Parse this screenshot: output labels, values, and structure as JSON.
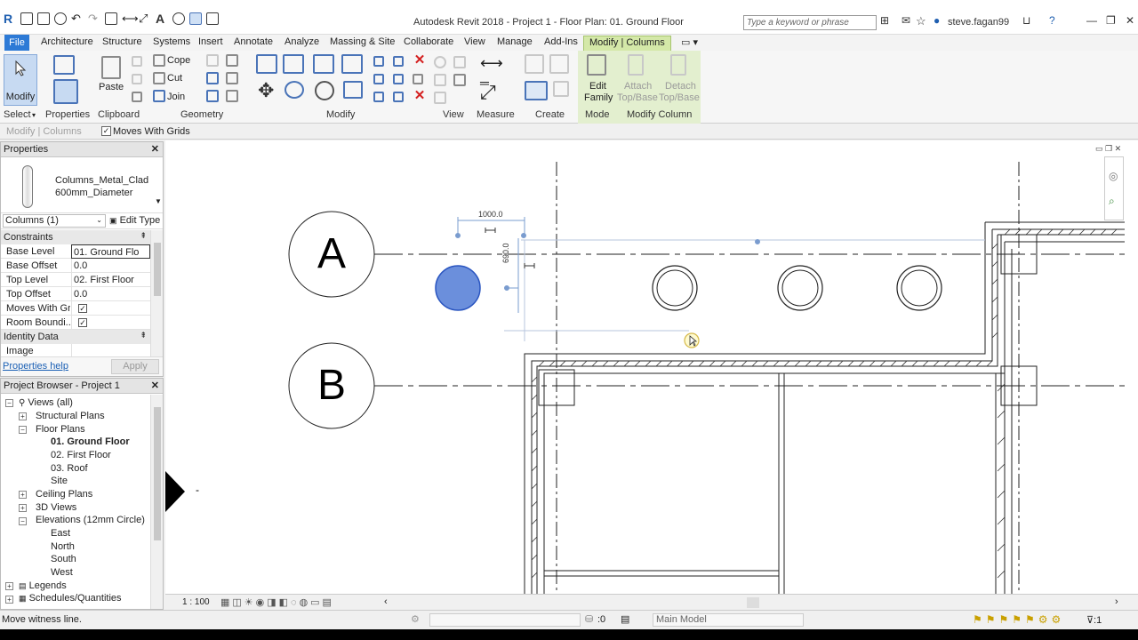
{
  "app": {
    "title": "Autodesk Revit 2018 -   Project 1 - Floor Plan: 01. Ground Floor",
    "search_placeholder": "Type a keyword or phrase",
    "user": "steve.fagan99"
  },
  "tabs": [
    "File",
    "Architecture",
    "Structure",
    "Systems",
    "Insert",
    "Annotate",
    "Analyze",
    "Massing & Site",
    "Collaborate",
    "View",
    "Manage",
    "Add-Ins",
    "Modify | Columns"
  ],
  "ribbon": {
    "modify_label": "Modify",
    "paste_label": "Paste",
    "cope_label": "Cope",
    "cut_label": "Cut",
    "join_label": "Join",
    "edit_family_line1": "Edit",
    "edit_family_line2": "Family",
    "attach_line1": "Attach",
    "attach_line2": "Top/Base",
    "detach_line1": "Detach",
    "detach_line2": "Top/Base",
    "panels": {
      "select": "Select",
      "properties": "Properties",
      "clipboard": "Clipboard",
      "geometry": "Geometry",
      "modify": "Modify",
      "view": "View",
      "measure": "Measure",
      "create": "Create",
      "mode": "Mode",
      "modify_column": "Modify Column"
    }
  },
  "options_bar": {
    "context": "Modify | Columns",
    "moves_with_grids_label": "Moves With Grids",
    "moves_with_grids_checked": true
  },
  "properties": {
    "header": "Properties",
    "type_name_line1": "Columns_Metal_Clad",
    "type_name_line2": "600mm_Diameter",
    "instance_filter": "Columns (1)",
    "edit_type": "Edit Type",
    "groups": {
      "constraints": "Constraints",
      "identity": "Identity Data"
    },
    "rows": [
      {
        "key": "Base Level",
        "value": "01. Ground Flo"
      },
      {
        "key": "Base Offset",
        "value": "0.0"
      },
      {
        "key": "Top Level",
        "value": "02. First Floor"
      },
      {
        "key": "Top Offset",
        "value": "0.0"
      },
      {
        "key": "Moves With Gr...",
        "value": "✓"
      },
      {
        "key": "Room Boundi...",
        "value": "✓"
      }
    ],
    "image_key": "Image",
    "help_link": "Properties help",
    "apply": "Apply"
  },
  "browser": {
    "header": "Project Browser - Project 1",
    "items": [
      "Views (all)",
      "Structural Plans",
      "Floor Plans",
      "01. Ground Floor",
      "02. First Floor",
      "03. Roof",
      "Site",
      "Ceiling Plans",
      "3D Views",
      "Elevations (12mm Circle)",
      "East",
      "North",
      "South",
      "West",
      "Legends",
      "Schedules/Quantities"
    ]
  },
  "drawing": {
    "grid_a": "A",
    "grid_b": "B",
    "dim_horizontal": "1000.0",
    "dim_vertical": "690.0",
    "elevation_dash": "-"
  },
  "view_control": {
    "scale": "1 : 100"
  },
  "status_bar": {
    "message": "Move witness line.",
    "zero": ":0",
    "model": "Main Model"
  },
  "colors": {
    "accent_blue": "#2d7ad6",
    "context_tab_green": "#d4e8a8",
    "selected_column_fill": "#6b8fdc"
  }
}
